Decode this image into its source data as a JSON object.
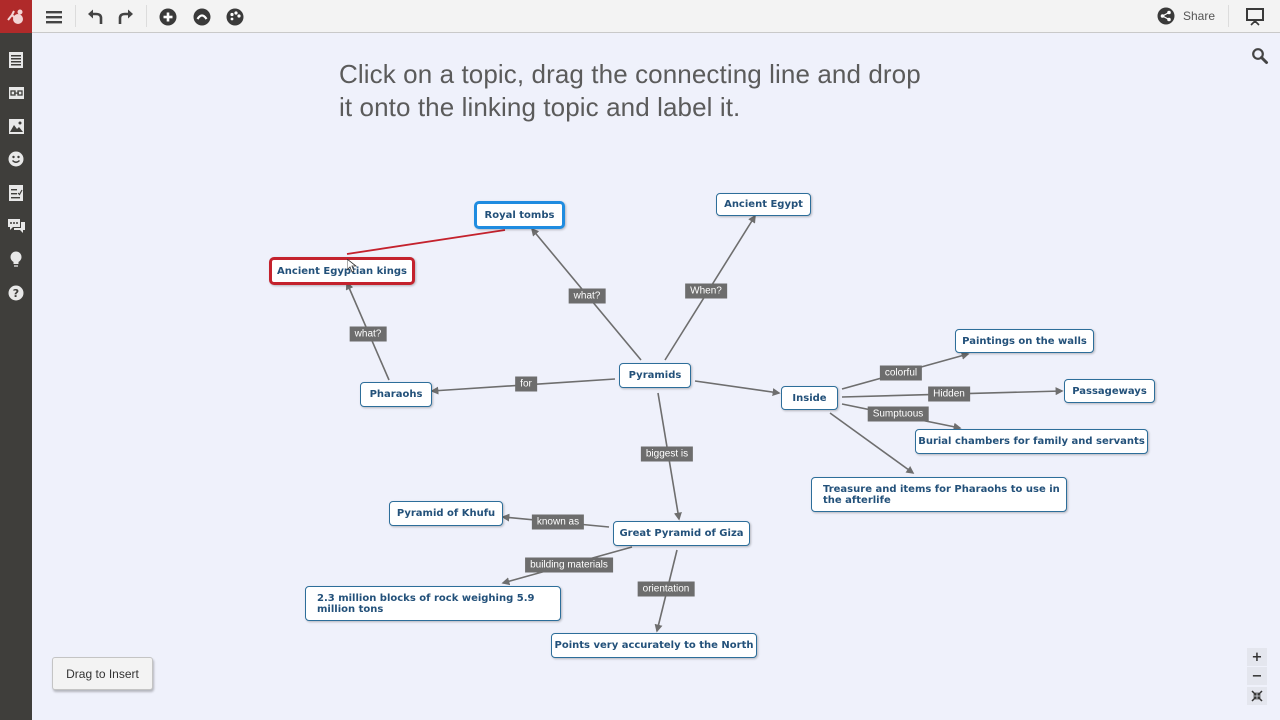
{
  "toolbar": {
    "share_label": "Share",
    "icons": [
      "logo-icon",
      "menu-icon",
      "undo-icon",
      "redo-icon",
      "add-topic-icon",
      "style-icon",
      "theme-palette-icon",
      "share-icon",
      "present-icon"
    ]
  },
  "sidebar": {
    "items": [
      {
        "name": "outline"
      },
      {
        "name": "links"
      },
      {
        "name": "images"
      },
      {
        "name": "stickers"
      },
      {
        "name": "tasks"
      },
      {
        "name": "comments"
      },
      {
        "name": "ideas"
      },
      {
        "name": "help"
      }
    ]
  },
  "instruction": {
    "line1": "Click on a topic, drag the connecting line and drop",
    "line2": "it onto the linking topic and label it."
  },
  "topics": {
    "royal_tombs": "Royal tombs",
    "ancient_egyptian_kings": "Ancient Egyptian kings",
    "ancient_egypt": "Ancient Egypt",
    "pyramids": "Pyramids",
    "pharaohs": "Pharaohs",
    "inside": "Inside",
    "paintings": "Paintings on the walls",
    "passageways": "Passageways",
    "burial_chambers": "Burial chambers for family and servants",
    "treasure": "Treasure and items for Pharaohs to use in the afterlife",
    "great_pyramid": "Great Pyramid of Giza",
    "khufu": "Pyramid of Khufu",
    "blocks": "2.3 million blocks of rock weighing 5.9 million tons",
    "north": "Points very accurately to the North"
  },
  "link_labels": {
    "pyramids_royal": "what?",
    "pyramids_egypt": "When?",
    "pharaohs_kings": "what?",
    "pyramids_pharaohs": "for",
    "pyramids_great": "biggest is",
    "inside_paintings": "colorful",
    "inside_passage": "Hidden",
    "inside_burial": "Sumptuous",
    "great_khufu": "known as",
    "great_blocks": "building materials",
    "great_north": "orientation"
  },
  "insert_button": "Drag to Insert",
  "zoom_controls": {
    "zoom_in": "+",
    "zoom_out": "−"
  },
  "colors": {
    "brand": "#b02a2a",
    "topic_border": "#2d6e9a",
    "topic_text": "#23517a",
    "selected_blue": "#1f8ce0",
    "selected_red": "#c4222d",
    "link_label_bg": "#6d6d6d",
    "link_line": "#6e6e6e",
    "canvas_bg": "#eff1fb"
  }
}
